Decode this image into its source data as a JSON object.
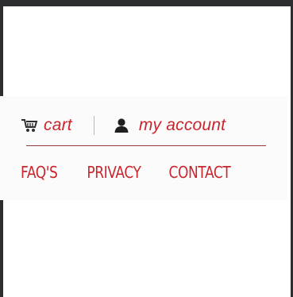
{
  "colors": {
    "accent": "#c9252c",
    "frame": "#2b2f30",
    "background": "#ffffff",
    "divider": "#8e3a3a"
  },
  "header": {
    "cart": {
      "icon": "shopping-cart-icon",
      "label": "cart"
    },
    "account": {
      "icon": "user-icon",
      "label": "my account"
    }
  },
  "nav": {
    "links": [
      {
        "label": "FAQ'S"
      },
      {
        "label": "PRIVACY"
      },
      {
        "label": "CONTACT"
      }
    ]
  }
}
